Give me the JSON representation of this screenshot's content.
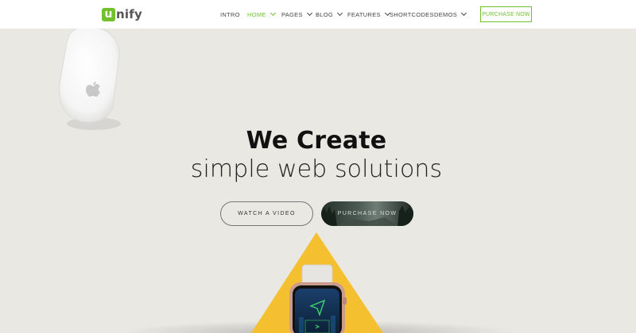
{
  "brand": {
    "logo_letter": "u",
    "logo_rest": "nify"
  },
  "nav": {
    "items": [
      {
        "label": "INTRO"
      },
      {
        "label": "HOME"
      },
      {
        "label": "PAGES"
      },
      {
        "label": "BLOG"
      },
      {
        "label": "FEATURES"
      },
      {
        "label": "SHORTCODES"
      },
      {
        "label": "DEMOS"
      }
    ],
    "cta_label": "PURCHASE NOW"
  },
  "hero": {
    "title": "We Create",
    "subtitle": "simple web solutions",
    "watch_label": "WATCH A VIDEO",
    "purchase_label": "PURCHASE NOW"
  },
  "colors": {
    "accent": "#72c02c",
    "triangle": "#f5c030",
    "background": "#e9e8e3"
  }
}
